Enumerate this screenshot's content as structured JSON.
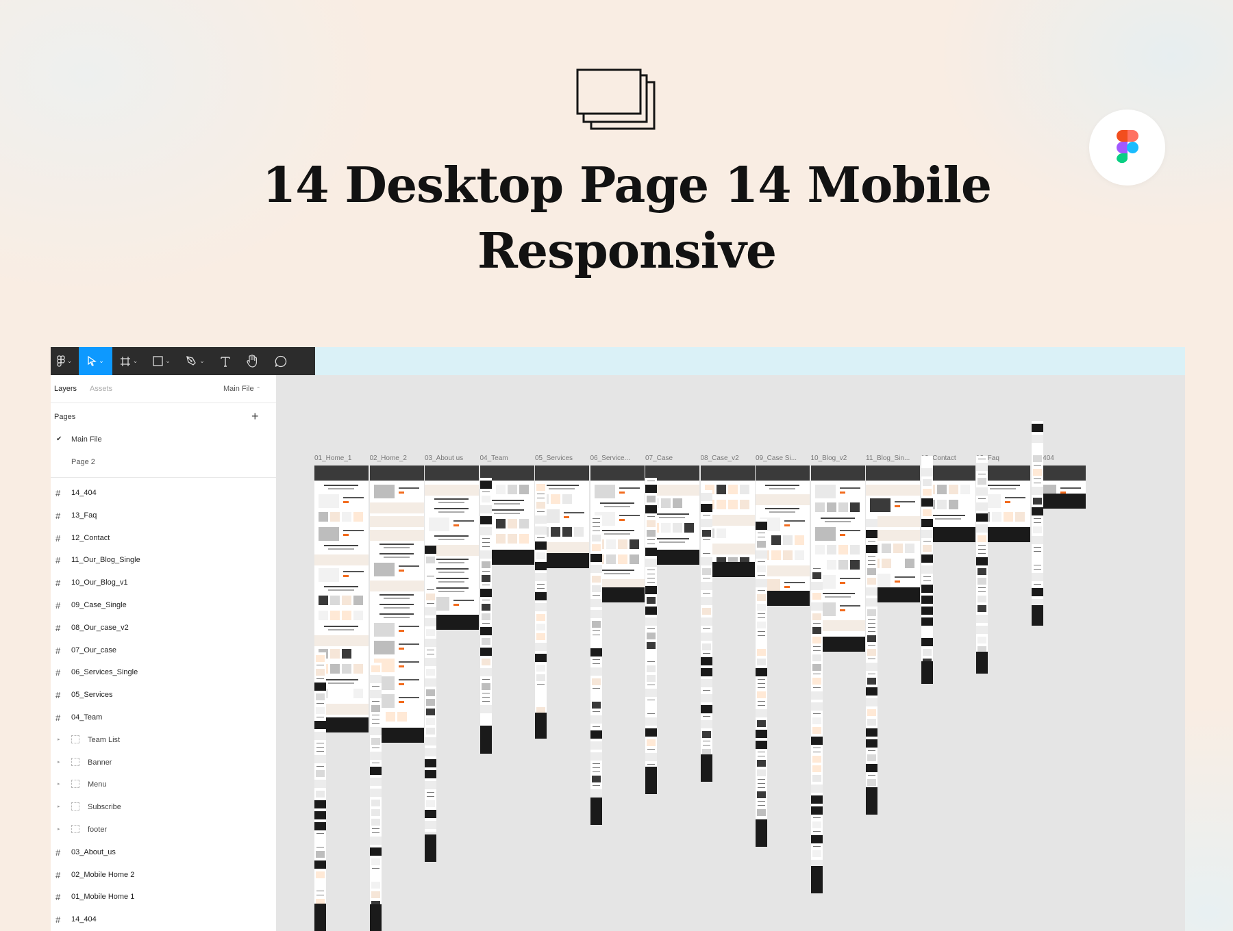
{
  "hero": {
    "icon": "stacked-frames-icon",
    "title": "14 Desktop Page 14 Mobile Responsive",
    "badge_icon": "figma-logo-icon"
  },
  "toolbar": {
    "items": [
      "figma-menu-icon",
      "move-tool-icon",
      "frame-tool-icon",
      "shape-tool-icon",
      "pen-tool-icon",
      "text-tool-icon",
      "hand-tool-icon",
      "comment-tool-icon"
    ],
    "active_color": "#0d99ff"
  },
  "sidebar": {
    "tabs": {
      "layers": "Layers",
      "assets": "Assets",
      "file_selector": "Main File"
    },
    "pages_heading": "Pages",
    "add_page": "+",
    "pages": [
      {
        "label": "Main File",
        "selected": true
      },
      {
        "label": "Page 2",
        "selected": false
      }
    ],
    "layers": [
      {
        "label": "14_404",
        "type": "frame"
      },
      {
        "label": "13_Faq",
        "type": "frame"
      },
      {
        "label": "12_Contact",
        "type": "frame"
      },
      {
        "label": "11_Our_Blog_Single",
        "type": "frame"
      },
      {
        "label": "10_Our_Blog_v1",
        "type": "frame"
      },
      {
        "label": "09_Case_Single",
        "type": "frame"
      },
      {
        "label": "08_Our_case_v2",
        "type": "frame"
      },
      {
        "label": "07_Our_case",
        "type": "frame"
      },
      {
        "label": "06_Services_Single",
        "type": "frame"
      },
      {
        "label": "05_Services",
        "type": "frame"
      },
      {
        "label": "04_Team",
        "type": "frame"
      },
      {
        "label": "Team List",
        "type": "group"
      },
      {
        "label": "Banner",
        "type": "group"
      },
      {
        "label": "Menu",
        "type": "group"
      },
      {
        "label": "Subscribe",
        "type": "group"
      },
      {
        "label": "footer",
        "type": "group"
      },
      {
        "label": "03_About_us",
        "type": "frame"
      },
      {
        "label": "02_Mobile Home 2",
        "type": "frame"
      },
      {
        "label": "01_Mobile Home 1",
        "type": "frame"
      },
      {
        "label": "14_404",
        "type": "frame"
      }
    ]
  },
  "canvas": {
    "frames": [
      {
        "label": "01_Home_1"
      },
      {
        "label": "02_Home_2"
      },
      {
        "label": "03_About us"
      },
      {
        "label": "04_Team"
      },
      {
        "label": "05_Services"
      },
      {
        "label": "06_Service..."
      },
      {
        "label": "07_Case"
      },
      {
        "label": "08_Case_v2"
      },
      {
        "label": "09_Case Si..."
      },
      {
        "label": "10_Blog_v2"
      },
      {
        "label": "11_Blog_Sin..."
      },
      {
        "label": "12_Contact"
      },
      {
        "label": "13_Faq"
      },
      {
        "label": "14_404"
      }
    ]
  },
  "colors": {
    "accent": "#f26b1d",
    "dark": "#1a1a1a",
    "canvas": "#e5e5e5",
    "page_bg": "#f9ede3"
  }
}
